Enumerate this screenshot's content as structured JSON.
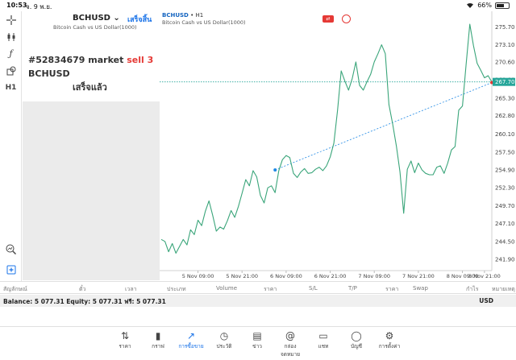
{
  "status_bar": {
    "time": "10:53",
    "date": "จ. 9 พ.ย.",
    "battery": "66%",
    "battery_level": 0.66
  },
  "info": {
    "symbol": "BCHUSD",
    "description": "Bitcoin Cash vs US Dollar(1000)",
    "done_link": "เสร็จสิ้น",
    "order_id": "#52834679",
    "order_word": "market",
    "order_action": "sell 3",
    "order_symbol": "BCHUSD",
    "order_status": "เสร็จแล้ว"
  },
  "chart": {
    "symbol": "BCHUSD",
    "timeframe": "H1",
    "description": "Bitcoin Cash vs US Dollar(1000)",
    "current_price": "267.70"
  },
  "chart_data": {
    "type": "line",
    "ylim": [
      240.5,
      277.5
    ],
    "y_ticks": [
      "275.70",
      "273.10",
      "270.60",
      "268.00",
      "265.30",
      "262.80",
      "260.10",
      "257.50",
      "254.90",
      "252.30",
      "249.70",
      "247.10",
      "244.50",
      "241.90"
    ],
    "x_ticks": [
      "5 Nov 09:00",
      "5 Nov 21:00",
      "6 Nov 09:00",
      "6 Nov 21:00",
      "7 Nov 09:00",
      "7 Nov 21:00",
      "8 Nov 09:00",
      "8 Nov 21:00"
    ],
    "x_range": [
      -4,
      86
    ],
    "x_tick_pos": [
      6,
      18,
      30,
      42,
      54,
      66,
      78,
      84
    ],
    "current_price": 267.7,
    "trend_line": {
      "from": [
        27,
        254.9
      ],
      "to": [
        86,
        267.6
      ]
    },
    "series": [
      {
        "values": [
          [
            -4,
            244.8
          ],
          [
            -3,
            244.5
          ],
          [
            -2,
            243.0
          ],
          [
            -1,
            244.2
          ],
          [
            0,
            242.8
          ],
          [
            1,
            243.8
          ],
          [
            2,
            244.8
          ],
          [
            3,
            244.0
          ],
          [
            4,
            246.2
          ],
          [
            5,
            245.5
          ],
          [
            6,
            247.6
          ],
          [
            7,
            246.8
          ],
          [
            8,
            248.9
          ],
          [
            9,
            250.4
          ],
          [
            10,
            248.3
          ],
          [
            11,
            246.0
          ],
          [
            12,
            246.6
          ],
          [
            13,
            246.3
          ],
          [
            14,
            247.5
          ],
          [
            15,
            249.0
          ],
          [
            16,
            248.0
          ],
          [
            17,
            249.6
          ],
          [
            18,
            251.5
          ],
          [
            19,
            253.5
          ],
          [
            20,
            252.6
          ],
          [
            21,
            254.8
          ],
          [
            22,
            253.9
          ],
          [
            23,
            251.2
          ],
          [
            24,
            250.1
          ],
          [
            25,
            252.3
          ],
          [
            26,
            252.6
          ],
          [
            27,
            251.6
          ],
          [
            28,
            254.8
          ],
          [
            29,
            256.4
          ],
          [
            30,
            257.0
          ],
          [
            31,
            256.7
          ],
          [
            32,
            254.4
          ],
          [
            33,
            253.8
          ],
          [
            34,
            254.6
          ],
          [
            35,
            255.1
          ],
          [
            36,
            254.4
          ],
          [
            37,
            254.5
          ],
          [
            38,
            255.0
          ],
          [
            39,
            255.3
          ],
          [
            40,
            254.8
          ],
          [
            41,
            255.5
          ],
          [
            42,
            256.8
          ],
          [
            43,
            258.8
          ],
          [
            44,
            263.6
          ],
          [
            45,
            269.3
          ],
          [
            46,
            267.8
          ],
          [
            47,
            266.5
          ],
          [
            48,
            268.2
          ],
          [
            49,
            270.6
          ],
          [
            50,
            267.2
          ],
          [
            51,
            266.5
          ],
          [
            52,
            267.7
          ],
          [
            53,
            268.8
          ],
          [
            54,
            270.6
          ],
          [
            55,
            271.8
          ],
          [
            56,
            273.1
          ],
          [
            57,
            271.8
          ],
          [
            58,
            264.4
          ],
          [
            59,
            261.6
          ],
          [
            60,
            258.4
          ],
          [
            61,
            254.6
          ],
          [
            62,
            248.6
          ],
          [
            63,
            255.0
          ],
          [
            64,
            256.2
          ],
          [
            65,
            254.5
          ],
          [
            66,
            255.9
          ],
          [
            67,
            254.9
          ],
          [
            68,
            254.4
          ],
          [
            69,
            254.2
          ],
          [
            70,
            254.2
          ],
          [
            71,
            255.3
          ],
          [
            72,
            255.5
          ],
          [
            73,
            254.4
          ],
          [
            74,
            255.9
          ],
          [
            75,
            257.8
          ],
          [
            76,
            258.3
          ],
          [
            77,
            263.6
          ],
          [
            78,
            264.2
          ],
          [
            79,
            270.2
          ],
          [
            80,
            276.1
          ],
          [
            81,
            273.0
          ],
          [
            82,
            270.4
          ],
          [
            83,
            269.4
          ],
          [
            84,
            268.3
          ],
          [
            85,
            268.6
          ],
          [
            86,
            267.7
          ]
        ]
      }
    ]
  },
  "table_header": [
    "สัญลักษณ์",
    "ตั๋ว",
    "เวลา",
    "ประเภท",
    "Volume",
    "ราคา",
    "S/L",
    "T/P",
    "ราคา",
    "Swap",
    "กำไร",
    "หมายเหตุ"
  ],
  "balance": {
    "text": "Balance: 5 077.31  Equity: 5 077.31  ฟรี: 5 077.31",
    "currency": "USD"
  },
  "tabs": [
    {
      "label": "ราคา",
      "icon": "arrows-updown-icon"
    },
    {
      "label": "กราฟ",
      "icon": "candles-icon"
    },
    {
      "label": "การซื้อขาย",
      "icon": "trade-chart-icon"
    },
    {
      "label": "ประวัติ",
      "icon": "history-icon"
    },
    {
      "label": "ข่าว",
      "icon": "news-icon"
    },
    {
      "label": "กล่องจดหมาย",
      "icon": "mail-at-icon"
    },
    {
      "label": "แชท",
      "icon": "chat-icon"
    },
    {
      "label": "บัญชี",
      "icon": "account-icon"
    },
    {
      "label": "การตั้งค่า",
      "icon": "settings-gear-icon"
    }
  ],
  "colors": {
    "accent": "#1a73e8",
    "line": "#3aa57a",
    "sell": "#e53935",
    "price_tag": "#26a69a",
    "trend": "#1e88e5"
  }
}
